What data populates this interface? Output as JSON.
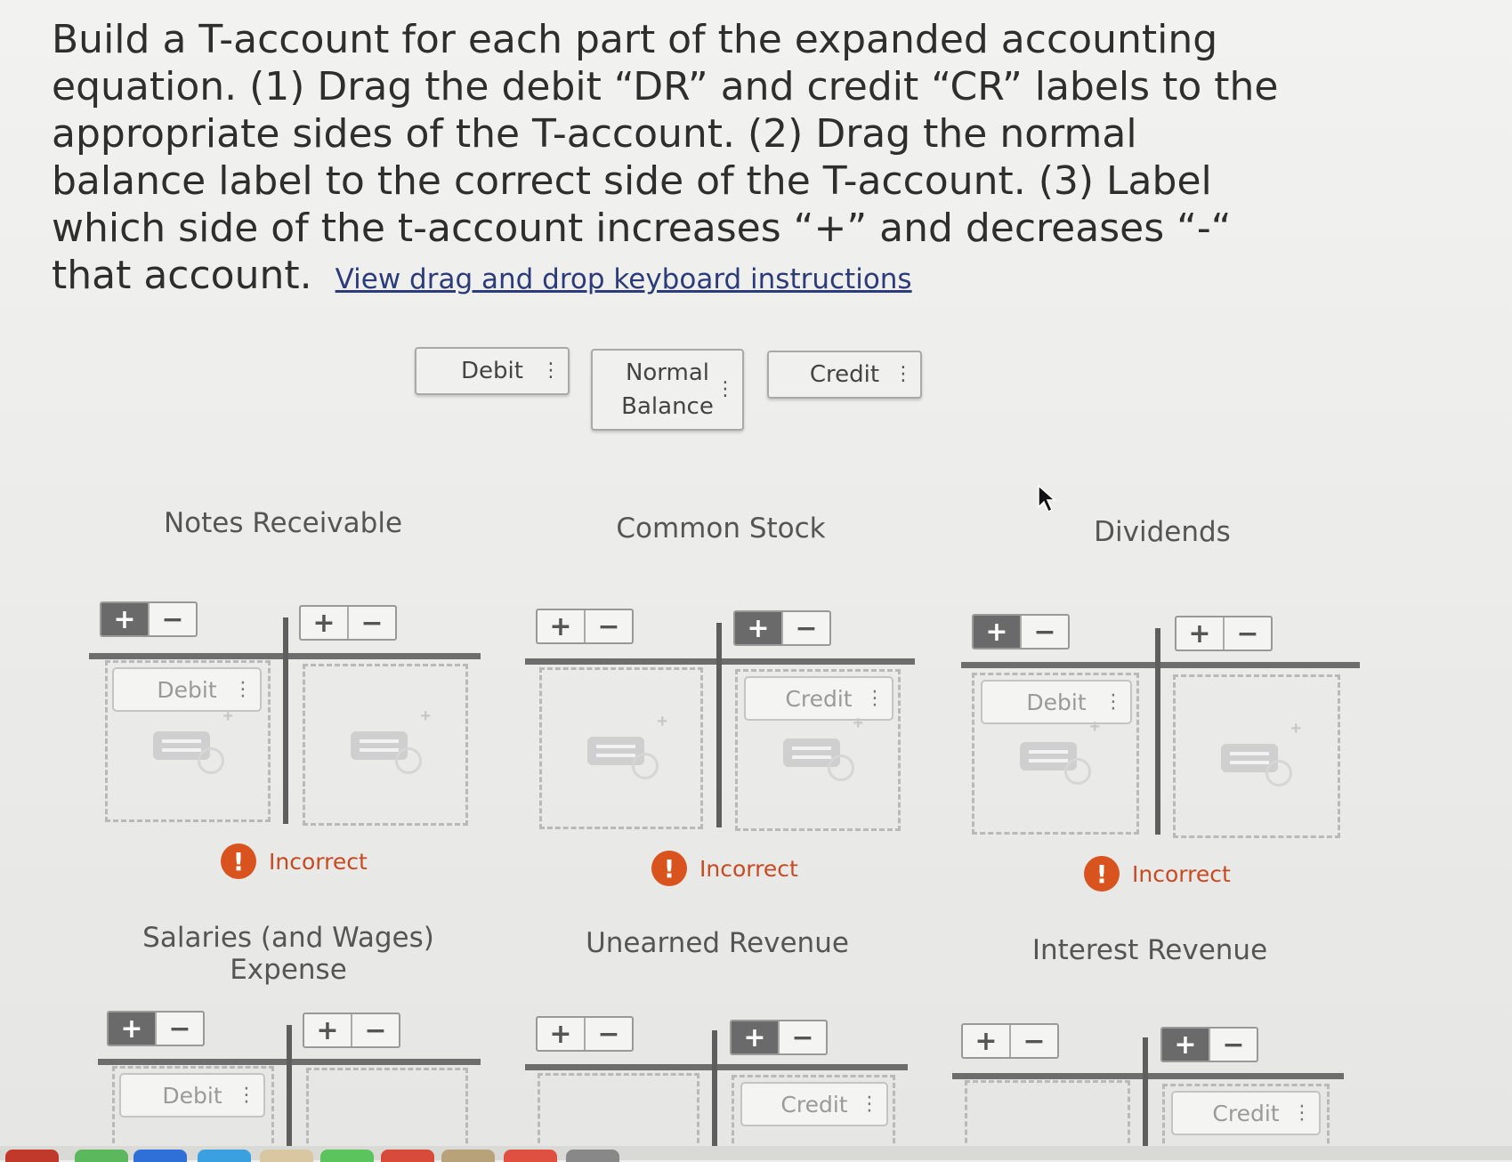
{
  "instructions": {
    "text": "Build a T-account for each part of the expanded accounting equation. (1) Drag the debit “DR” and credit “CR” labels to the appropriate sides of the T-account. (2) Drag the normal balance label to the correct side of the T-account. (3) Label which side of the t-account increases “+” and decreases “-“ that account.",
    "link": "View drag and drop keyboard instructions"
  },
  "chips": [
    {
      "label": "Debit"
    },
    {
      "label": "Normal Balance"
    },
    {
      "label": "Credit"
    }
  ],
  "pm": {
    "plus": "+",
    "minus": "−"
  },
  "accounts": [
    {
      "name": "Notes Receivable",
      "left_label": "Debit",
      "right_label": "",
      "status": "Incorrect"
    },
    {
      "name": "Common Stock",
      "left_label": "",
      "right_label": "Credit",
      "status": "Incorrect"
    },
    {
      "name": "Dividends",
      "left_label": "Debit",
      "right_label": "",
      "status": "Incorrect"
    },
    {
      "name": "Salaries (and Wages) Expense",
      "left_label": "Debit",
      "right_label": "",
      "status": ""
    },
    {
      "name": "Unearned Revenue",
      "left_label": "",
      "right_label": "Credit",
      "status": ""
    },
    {
      "name": "Interest Revenue",
      "left_label": "",
      "right_label": "Credit",
      "status": ""
    }
  ],
  "status_icon": "!",
  "colors": {
    "incorrect": "#d9531e",
    "link": "#2c3b7a"
  }
}
